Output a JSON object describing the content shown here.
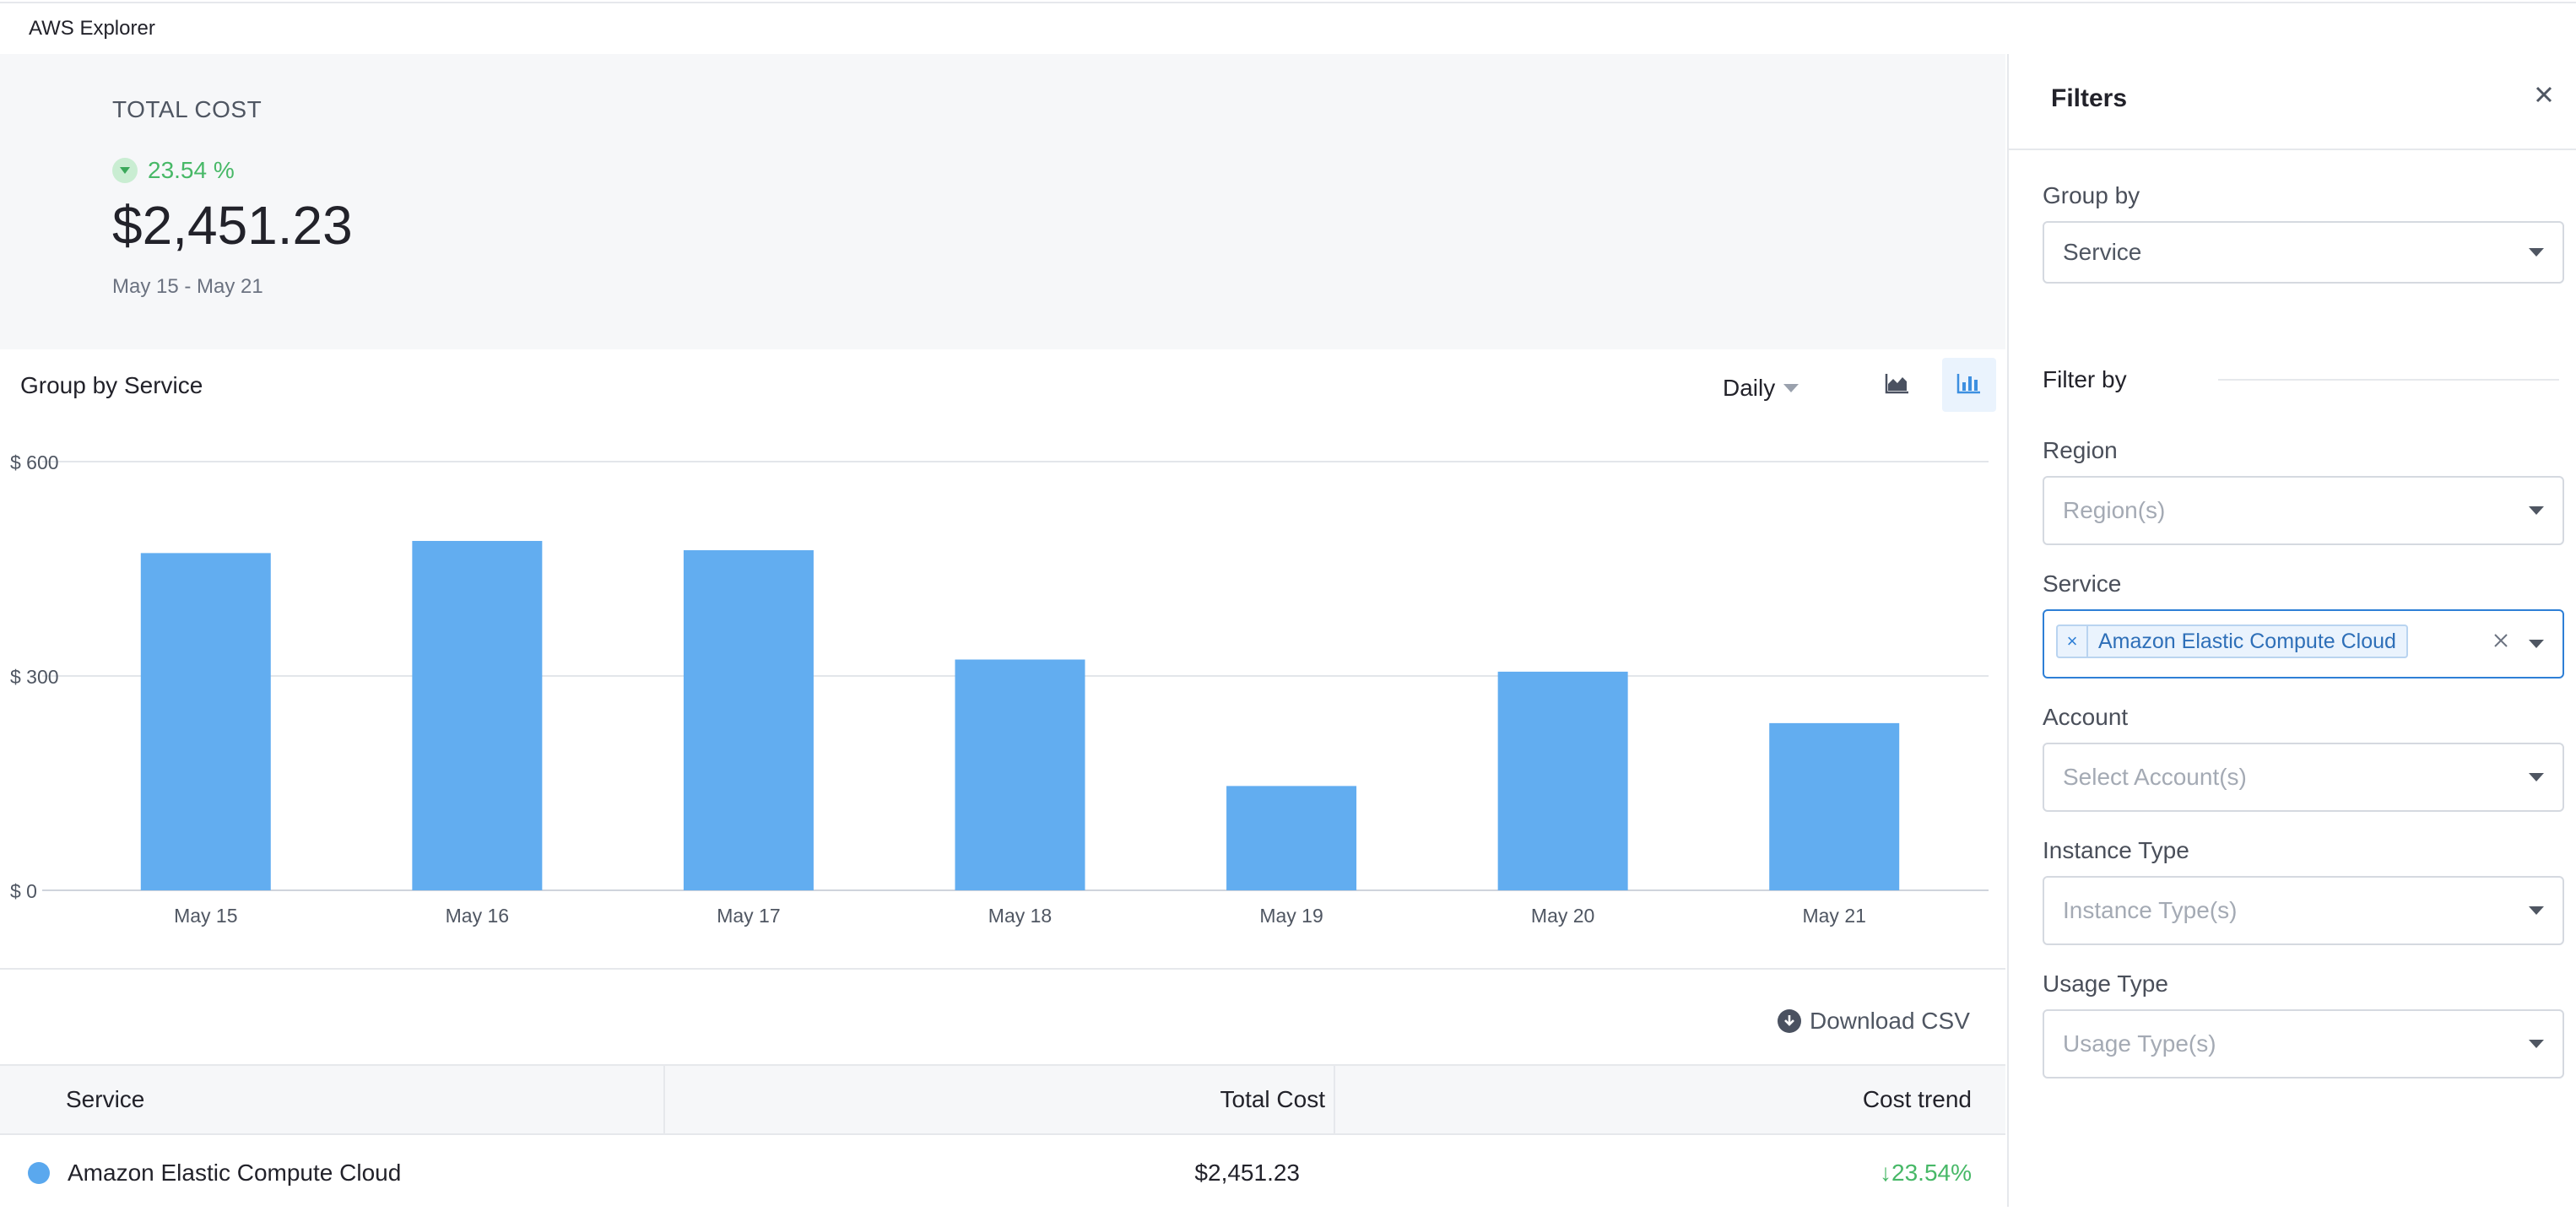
{
  "app": {
    "title": "AWS Explorer"
  },
  "summary": {
    "label": "TOTAL COST",
    "trend_pct": "23.54 %",
    "trend_direction": "down",
    "total": "$2,451.23",
    "date_range": "May 15 - May 21"
  },
  "chart_header": {
    "title": "Group by Service",
    "interval": "Daily",
    "views": [
      {
        "icon": "area-chart-icon",
        "active": false
      },
      {
        "icon": "bar-chart-icon",
        "active": true
      }
    ]
  },
  "chart_data": {
    "type": "bar",
    "categories": [
      "May 15",
      "May 16",
      "May 17",
      "May 18",
      "May 19",
      "May 20",
      "May 21"
    ],
    "series": [
      {
        "name": "Amazon Elastic Compute Cloud",
        "color": "#62adf0",
        "values": [
          472,
          489,
          476,
          323,
          146,
          306,
          234
        ]
      }
    ],
    "yticks": [
      "$ 0",
      "$ 300",
      "$ 600"
    ],
    "ytick_values": [
      0,
      300,
      600
    ],
    "ylim": [
      0,
      600
    ],
    "grid": true,
    "title": "",
    "xlabel": "",
    "ylabel": ""
  },
  "download": {
    "label": "Download CSV"
  },
  "table": {
    "headers": [
      "Service",
      "Total Cost",
      "Cost trend"
    ],
    "rows": [
      {
        "service": "Amazon Elastic Compute Cloud",
        "total": "$2,451.23",
        "trend": "↓23.54%",
        "color": "#5aa8ee"
      }
    ]
  },
  "filters": {
    "title": "Filters",
    "group_by": {
      "label": "Group by",
      "value": "Service"
    },
    "filter_by_label": "Filter by",
    "region": {
      "label": "Region",
      "placeholder": "Region(s)"
    },
    "service": {
      "label": "Service",
      "selected": [
        "Amazon Elastic Compute Cloud"
      ]
    },
    "account": {
      "label": "Account",
      "placeholder": "Select Account(s)"
    },
    "instance_type": {
      "label": "Instance Type",
      "placeholder": "Instance Type(s)"
    },
    "usage_type": {
      "label": "Usage Type",
      "placeholder": "Usage Type(s)"
    }
  }
}
